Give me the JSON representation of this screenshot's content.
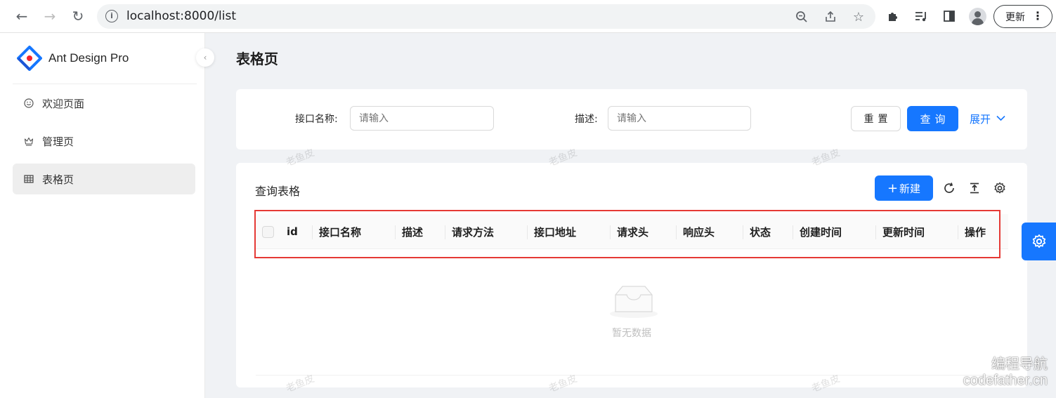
{
  "browser": {
    "url": "localhost:8000/list",
    "update_label": "更新",
    "icons": {
      "back": "arrow-left-icon",
      "forward": "arrow-right-icon",
      "reload": "reload-icon",
      "info": "info-icon",
      "zoom": "zoom-icon",
      "share": "share-icon",
      "bookmark": "star-icon",
      "extensions": "puzzle-icon",
      "media": "media-icon",
      "sidepanel": "side-panel-icon",
      "profile": "avatar-icon",
      "menu": "more-vert-icon"
    }
  },
  "sidebar": {
    "brand": "Ant Design Pro",
    "items": [
      {
        "label": "欢迎页面",
        "icon": "smile-icon",
        "active": false
      },
      {
        "label": "管理页",
        "icon": "crown-icon",
        "active": false
      },
      {
        "label": "表格页",
        "icon": "table-icon",
        "active": true
      }
    ]
  },
  "page": {
    "title": "表格页"
  },
  "search": {
    "fields": [
      {
        "label": "接口名称:",
        "placeholder": "请输入"
      },
      {
        "label": "描述:",
        "placeholder": "请输入"
      }
    ],
    "reset_label": "重置",
    "query_label": "查询",
    "expand_label": "展开"
  },
  "table": {
    "title": "查询表格",
    "new_label": "新建",
    "columns": [
      "id",
      "接口名称",
      "描述",
      "请求方法",
      "接口地址",
      "请求头",
      "响应头",
      "状态",
      "创建时间",
      "更新时间",
      "操作"
    ],
    "empty_text": "暂无数据"
  },
  "watermark_text": "老鱼皮",
  "site_mark": {
    "line1": "编程导航",
    "line2": "codefather.cn"
  },
  "colors": {
    "primary": "#1677ff",
    "highlight_border": "#e53935"
  }
}
